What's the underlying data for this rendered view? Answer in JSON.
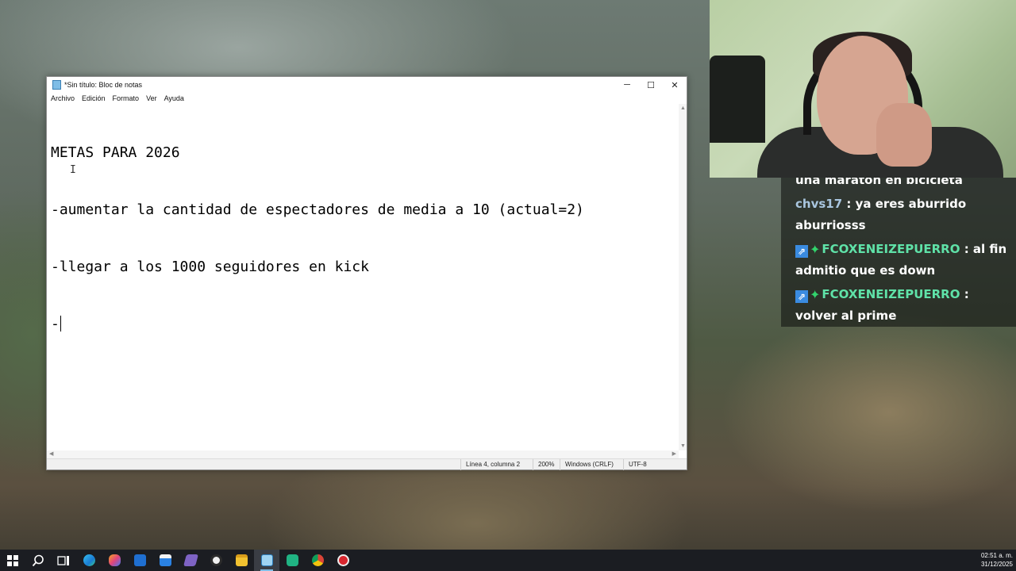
{
  "notepad": {
    "title": "*Sin título: Bloc de notas",
    "controls": {
      "minimize": "─",
      "maximize": "☐",
      "close": "✕"
    },
    "menu": [
      "Archivo",
      "Edición",
      "Formato",
      "Ver",
      "Ayuda"
    ],
    "lines": [
      "METAS PARA 2026",
      "-aumentar la cantidad de espectadores de media a 10 (actual=2)",
      "-llegar a los 1000 seguidores en kick",
      "-"
    ],
    "status": {
      "position": "Línea 4, columna 2",
      "zoom": "200%",
      "line_endings": "Windows (CRLF)",
      "encoding": "UTF-8"
    }
  },
  "chat": {
    "partial": "una maratón en bicicleta",
    "messages": [
      {
        "user": "chvs17",
        "text": "ya eres aburrido aburriosss"
      },
      {
        "user": "FCOXENEIZEPUERRO",
        "text": "al fin admitio que es down"
      },
      {
        "user": "FCOXENEIZEPUERRO",
        "text": "volver al prime"
      }
    ]
  },
  "taskbar": {
    "icons": [
      "windows-start",
      "search",
      "task-view",
      "edge",
      "copilot",
      "mail",
      "store",
      "visual-studio",
      "obs",
      "file-explorer",
      "notepad",
      "app-green",
      "chrome",
      "app-red"
    ],
    "time": "02:51 a. m.",
    "date": "31/12/2025"
  }
}
